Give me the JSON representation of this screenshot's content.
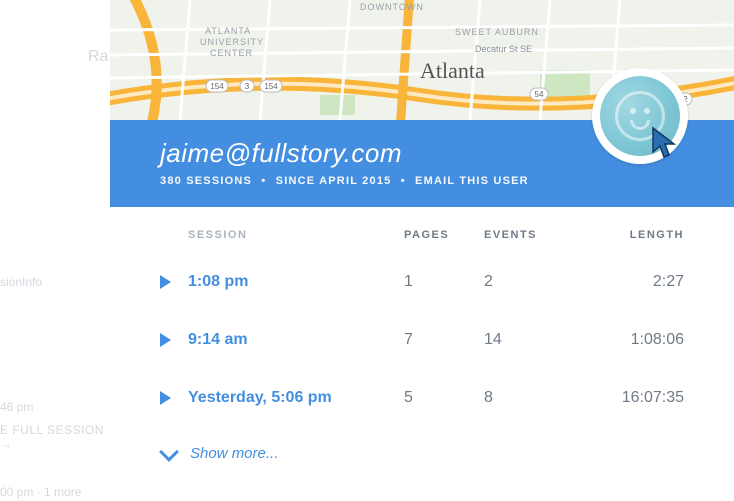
{
  "background_fragments": {
    "frag1": "Ra",
    "frag2": "sionInfo",
    "frag3": "46 pm",
    "frag4": "E FULL SESSION →",
    "frag5": "00 pm · 1 more"
  },
  "map": {
    "city_label": "Atlanta",
    "areas": [
      "DOWNTOWN",
      "SWEET AUBURN",
      "ATLANTA UNIVERSITY CENTER"
    ],
    "route_labels": [
      "154",
      "3",
      "154",
      "54",
      "402"
    ],
    "street_label": "Decatur St SE"
  },
  "user": {
    "email": "jaime@fullstory.com",
    "sessions_count": "380 SESSIONS",
    "since": "SINCE APRIL 2015",
    "email_action": "EMAIL THIS USER"
  },
  "columns": {
    "session": "SESSION",
    "pages": "PAGES",
    "events": "EVENTS",
    "length": "LENGTH"
  },
  "sessions": [
    {
      "time": "1:08 pm",
      "pages": "1",
      "events": "2",
      "length": "2:27"
    },
    {
      "time": "9:14 am",
      "pages": "7",
      "events": "14",
      "length": "1:08:06"
    },
    {
      "time": "Yesterday, 5:06 pm",
      "pages": "5",
      "events": "8",
      "length": "16:07:35"
    }
  ],
  "show_more": "Show more..."
}
